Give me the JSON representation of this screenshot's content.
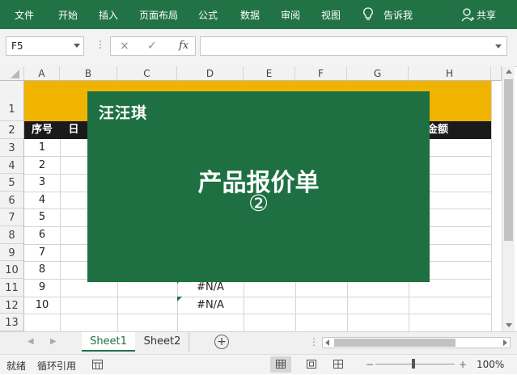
{
  "ribbon": {
    "tabs": [
      "文件",
      "开始",
      "插入",
      "页面布局",
      "公式",
      "数据",
      "审阅",
      "视图"
    ],
    "tell_me": "告诉我",
    "share": "共享"
  },
  "formula_bar": {
    "name_box": "F5",
    "cancel": "×",
    "enter": "✓",
    "fx": "fx",
    "formula": ""
  },
  "sheet": {
    "columns": [
      "A",
      "B",
      "C",
      "D",
      "E",
      "F",
      "G",
      "H"
    ],
    "rows": [
      "1",
      "2",
      "3",
      "4",
      "5",
      "6",
      "7",
      "8",
      "9",
      "10",
      "11",
      "12",
      "13"
    ],
    "header_row": {
      "a": "序号",
      "b_partial": "日",
      "h": "金额"
    },
    "serials": [
      "1",
      "2",
      "3",
      "4",
      "5",
      "6",
      "7",
      "8",
      "9",
      "10"
    ],
    "d_values": [
      "#N/A",
      "#N/A"
    ]
  },
  "overlay": {
    "brand": "汪汪琪",
    "title": "产品报价单",
    "number": "②"
  },
  "tabs": {
    "sheet1": "Sheet1",
    "sheet2": "Sheet2",
    "add": "+"
  },
  "status": {
    "ready": "就绪",
    "circular": "循环引用",
    "zoom": "100%",
    "minus": "−",
    "plus": "+"
  },
  "colors": {
    "ribbon": "#217346",
    "title_band": "#f0b400",
    "header_row": "#1a1a1a",
    "overlay": "#1e7042"
  }
}
